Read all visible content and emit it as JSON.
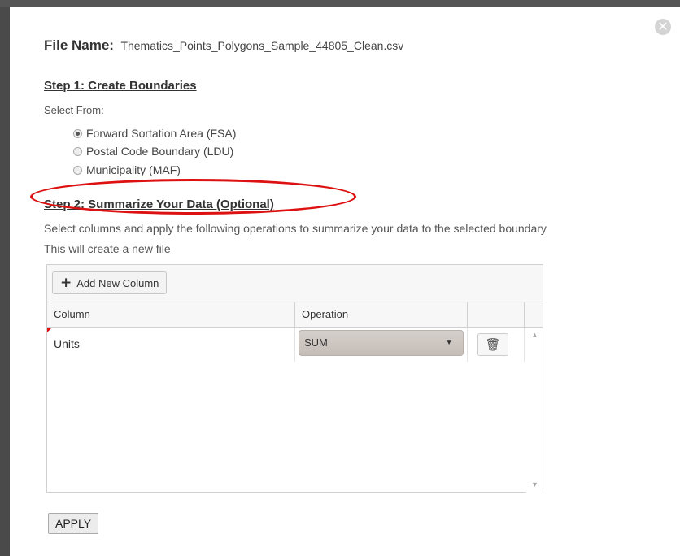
{
  "dialog": {
    "close_icon": "close-circle-icon",
    "file_name_label": "File Name:",
    "file_name_value": "Thematics_Points_Polygons_Sample_44805_Clean.csv"
  },
  "step1": {
    "title": "Step 1: Create Boundaries",
    "select_from": "Select From:",
    "options": [
      {
        "label": "Forward Sortation Area (FSA)",
        "checked": true
      },
      {
        "label": "Postal Code Boundary (LDU)",
        "checked": false
      },
      {
        "label": "Municipality (MAF)",
        "checked": false
      }
    ]
  },
  "step2": {
    "title": "Step 2: Summarize Your Data (Optional)",
    "desc1": "Select columns and apply the following operations to summarize your data to the selected boundary",
    "desc2": "This will create a new file"
  },
  "grid": {
    "add_button": "Add New Column",
    "headers": {
      "column": "Column",
      "operation": "Operation"
    },
    "rows": [
      {
        "column": "Units",
        "operation": "SUM"
      }
    ]
  },
  "apply_button": "APPLY",
  "colors": {
    "highlight": "#dd1111",
    "accent_marker": "#dd1111"
  }
}
